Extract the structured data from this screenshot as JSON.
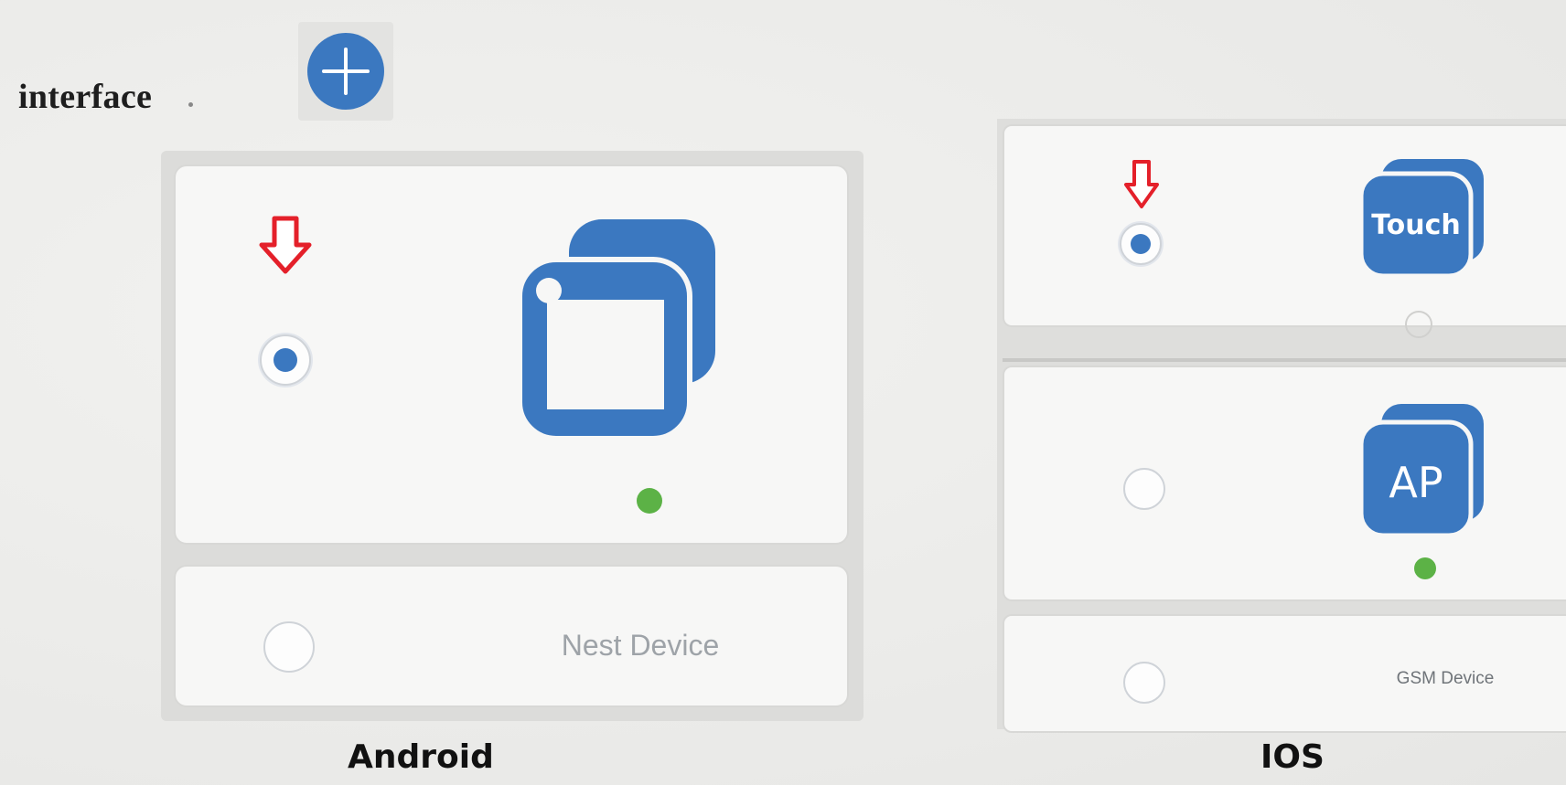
{
  "intro": {
    "text": "interface"
  },
  "colors": {
    "accent_blue": "#3b78c0",
    "status_green": "#5cb246",
    "arrow_red": "#e4202a",
    "label_gray": "#9ea3a8"
  },
  "android": {
    "platform_label": "Android",
    "options": [
      {
        "icon": "wifi-device-icon",
        "selected": true
      },
      {
        "label": "Nest Device",
        "selected": false
      }
    ]
  },
  "ios": {
    "platform_label": "IOS",
    "options": [
      {
        "icon": "touch-icon",
        "icon_text": "Touch",
        "selected": true
      },
      {
        "icon": "ap-icon",
        "icon_text": "AP",
        "selected": false
      },
      {
        "label": "GSM Device",
        "selected": false
      }
    ]
  }
}
